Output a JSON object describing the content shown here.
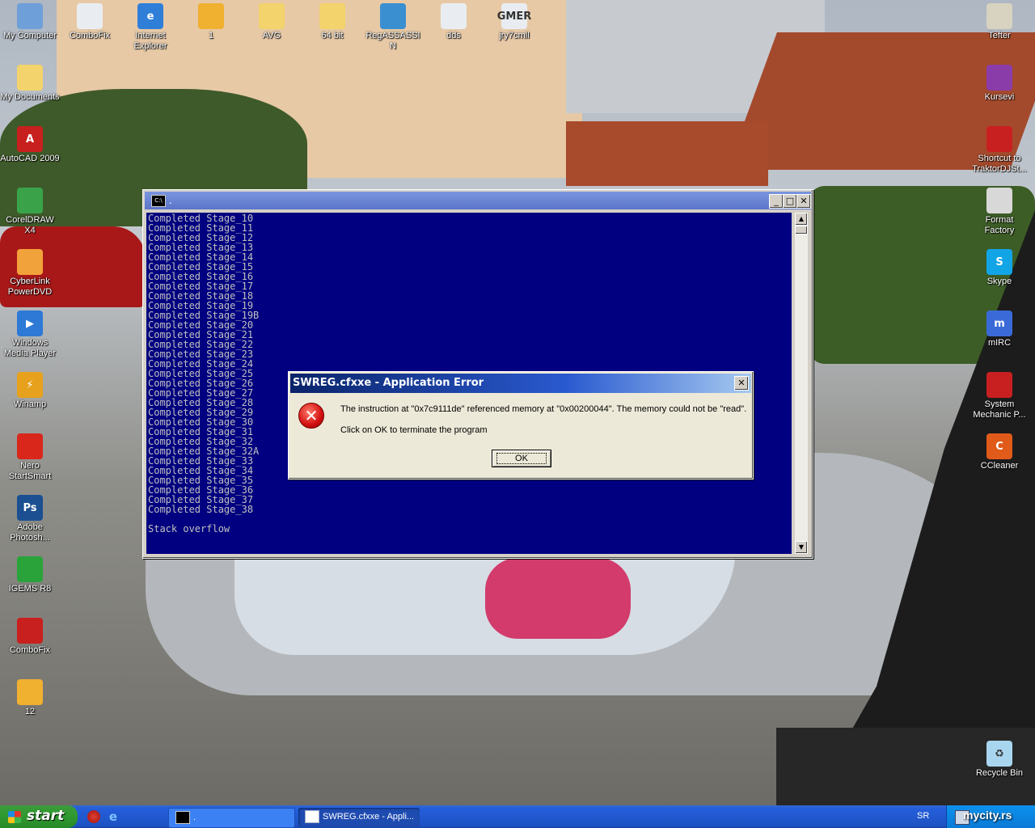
{
  "desktop": {
    "left_icons": [
      {
        "label": "My Computer",
        "icon": "my-computer-icon",
        "color": "#6e9fd8",
        "glyph": ""
      },
      {
        "label": "My Documents",
        "icon": "my-documents-icon",
        "color": "#f3d36b",
        "glyph": ""
      },
      {
        "label": "AutoCAD 2009",
        "icon": "autocad-icon",
        "color": "#c8201e",
        "glyph": "A"
      },
      {
        "label": "CorelDRAW X4",
        "icon": "coreldraw-icon",
        "color": "#3aa34a",
        "glyph": ""
      },
      {
        "label": "CyberLink PowerDVD",
        "icon": "powerdvd-icon",
        "color": "#f2a23a",
        "glyph": ""
      },
      {
        "label": "Windows Media Player",
        "icon": "media-player-icon",
        "color": "#2e79d6",
        "glyph": "▶"
      },
      {
        "label": "Winamp",
        "icon": "winamp-icon",
        "color": "#e7a11c",
        "glyph": "⚡"
      },
      {
        "label": "Nero StartSmart",
        "icon": "nero-icon",
        "color": "#d9271c",
        "glyph": ""
      },
      {
        "label": "Adobe Photosh...",
        "icon": "photoshop-icon",
        "color": "#1b4f91",
        "glyph": "Ps"
      },
      {
        "label": "IGEMS R8",
        "icon": "igems-icon",
        "color": "#2aa33a",
        "glyph": ""
      },
      {
        "label": "ComboFix",
        "icon": "combofix-icon",
        "color": "#c8201e",
        "glyph": ""
      },
      {
        "label": "12",
        "icon": "jpg-image-icon",
        "color": "#f0b030",
        "glyph": ""
      }
    ],
    "top_icons": [
      {
        "label": "ComboFix",
        "icon": "combofix-exe-icon",
        "color": "#e9edf2",
        "glyph": ""
      },
      {
        "label": "Internet Explorer",
        "icon": "internet-explorer-icon",
        "color": "#2f7fd9",
        "glyph": "e"
      },
      {
        "label": "1",
        "icon": "jpg-image-icon",
        "color": "#f0b030",
        "glyph": ""
      },
      {
        "label": "AVG",
        "icon": "folder-icon",
        "color": "#f3d36b",
        "glyph": ""
      },
      {
        "label": "64 bit",
        "icon": "folder-icon",
        "color": "#f3d36b",
        "glyph": ""
      },
      {
        "label": "RegASSASSIN",
        "icon": "regassassin-icon",
        "color": "#3a8fd0",
        "glyph": ""
      },
      {
        "label": "dds",
        "icon": "exe-window-icon",
        "color": "#e9edf2",
        "glyph": ""
      },
      {
        "label": "jry7cmll",
        "icon": "gmer-icon",
        "color": "#e9edf2",
        "glyph": "GMER"
      }
    ],
    "right_icons": [
      {
        "label": "Tefter",
        "icon": "tefter-icon",
        "color": "#d8d2c0",
        "glyph": ""
      },
      {
        "label": "Kursevi",
        "icon": "winrar-icon",
        "color": "#8a3ca8",
        "glyph": ""
      },
      {
        "label": "Shortcut to TraktorDJSt...",
        "icon": "traktor-icon",
        "color": "#c82020",
        "glyph": ""
      },
      {
        "label": "Format Factory",
        "icon": "format-factory-icon",
        "color": "#d8d8d8",
        "glyph": ""
      },
      {
        "label": "Skype",
        "icon": "skype-icon",
        "color": "#12a5e6",
        "glyph": "S"
      },
      {
        "label": "mIRC",
        "icon": "mirc-icon",
        "color": "#3a6ad8",
        "glyph": "m"
      },
      {
        "label": "System Mechanic P...",
        "icon": "system-mechanic-icon",
        "color": "#c82020",
        "glyph": ""
      },
      {
        "label": "CCleaner",
        "icon": "ccleaner-icon",
        "color": "#e05a1a",
        "glyph": "C"
      },
      {
        "label": "Recycle Bin",
        "icon": "recycle-bin-icon",
        "color": "#a9d6ef",
        "glyph": "♻"
      }
    ]
  },
  "console": {
    "title": ".",
    "icon_text": "C:\\",
    "lines": [
      "Completed Stage_10",
      "Completed Stage_11",
      "Completed Stage_12",
      "Completed Stage_13",
      "Completed Stage_14",
      "Completed Stage_15",
      "Completed Stage_16",
      "Completed Stage_17",
      "Completed Stage_18",
      "Completed Stage_19",
      "Completed Stage_19B",
      "Completed Stage_20",
      "Completed Stage_21",
      "Completed Stage_22",
      "Completed Stage_23",
      "Completed Stage_24",
      "Completed Stage_25",
      "Completed Stage_26",
      "Completed Stage_27",
      "Completed Stage_28",
      "Completed Stage_29",
      "Completed Stage_30",
      "Completed Stage_31",
      "Completed Stage_32",
      "Completed Stage_32A",
      "Completed Stage_33",
      "Completed Stage_34",
      "Completed Stage_35",
      "Completed Stage_36",
      "Completed Stage_37",
      "Completed Stage_38",
      "",
      "Stack overflow"
    ]
  },
  "dialog": {
    "title": "SWREG.cfxxe - Application Error",
    "message": "The instruction at \"0x7c9111de\" referenced memory at \"0x00200044\". The memory could not be \"read\".",
    "message2": "Click on OK to terminate the program",
    "ok_label": "OK"
  },
  "taskbar": {
    "start_label": "start",
    "buttons": [
      {
        "label": ".",
        "icon": "console-icon",
        "active": false
      },
      {
        "label": "SWREG.cfxxe - Appli...",
        "icon": "window-icon",
        "active": true
      }
    ],
    "language": "SR",
    "watermark": "mycity.rs"
  },
  "colors": {
    "console_bg": "#000080",
    "console_text": "#c0c0c0",
    "dialog_title": "#0a246a",
    "taskbar": "#245edb",
    "start_button": "#319a31"
  }
}
